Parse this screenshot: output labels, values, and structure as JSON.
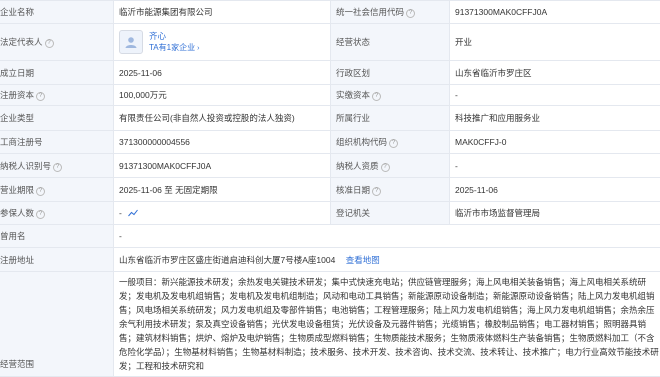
{
  "company_name": {
    "label": "企业名称",
    "value": "临沂市能源集团有限公司"
  },
  "credit_code": {
    "label": "统一社会信用代码",
    "value": "91371300MAK0CFFJ0A"
  },
  "legal_rep": {
    "label": "法定代表人",
    "name": "齐心",
    "sub": "TA有1家企业"
  },
  "status": {
    "label": "经营状态",
    "value": "开业"
  },
  "founded": {
    "label": "成立日期",
    "value": "2025-11-06"
  },
  "district": {
    "label": "行政区划",
    "value": "山东省临沂市罗庄区"
  },
  "reg_capital": {
    "label": "注册资本",
    "value": "100,000万元"
  },
  "paid_capital": {
    "label": "实缴资本",
    "value": "-"
  },
  "company_type": {
    "label": "企业类型",
    "value": "有限责任公司(非自然人投资或控股的法人独资)"
  },
  "industry": {
    "label": "所属行业",
    "value": "科技推广和应用服务业"
  },
  "reg_no": {
    "label": "工商注册号",
    "value": "371300000004556"
  },
  "org_code": {
    "label": "组织机构代码",
    "value": "MAK0CFFJ-0"
  },
  "taxpayer_id": {
    "label": "纳税人识别号",
    "value": "91371300MAK0CFFJ0A"
  },
  "taxpayer_qual": {
    "label": "纳税人资质",
    "value": "-"
  },
  "term": {
    "label": "营业期限",
    "value": "2025-11-06 至 无固定期限"
  },
  "approval_date": {
    "label": "核准日期",
    "value": "2025-11-06"
  },
  "insured": {
    "label": "参保人数",
    "value": "-"
  },
  "authority": {
    "label": "登记机关",
    "value": "临沂市市场监督管理局"
  },
  "former_name": {
    "label": "曾用名",
    "value": "-"
  },
  "address": {
    "label": "注册地址",
    "value": "山东省临沂市罗庄区盛庄街道启迪科创大厦7号楼A座1004",
    "map_link": "查看地图"
  },
  "scope": {
    "label": "经营范围",
    "value": "一般项目：新兴能源技术研发；余热发电关键技术研发；集中式快速充电站；供应链管理服务；海上风电相关装备销售；海上风电相关系统研发；发电机及发电机组销售；发电机及发电机组制造；风动和电动工具销售；新能源原动设备制造；新能源原动设备销售；陆上风力发电机组销售；风电场相关系统研发；风力发电机组及零部件销售；电池销售；工程管理服务；陆上风力发电机组销售；海上风力发电机组销售；余热余压余气利用技术研发；泵及真空设备销售；光伏发电设备租赁；光伏设备及元器件销售；光缆销售；橡胶制品销售；电工器材销售；照明器具销售；建筑材料销售；烘炉、熔炉及电炉销售；生物质成型燃料销售；生物质能技术服务；生物质液体燃料生产装备销售；生物质燃料加工（不含危险化学品）；生物基材料销售；生物基材料制造；技术服务、技术开发、技术咨询、技术交流、技术转让、技术推广；电力行业高效节能技术研发；工程和技术研究和"
  }
}
